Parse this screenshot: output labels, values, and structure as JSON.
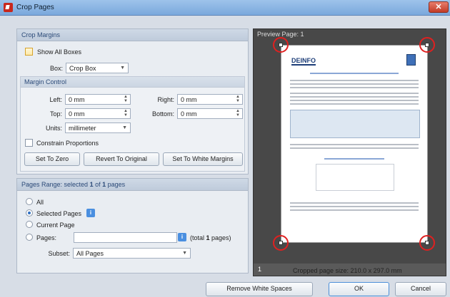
{
  "window": {
    "title": "Crop Pages",
    "close_label": "✕"
  },
  "crop_margins": {
    "header": "Crop Margins",
    "show_all_boxes_label": "Show All Boxes",
    "box_label": "Box:",
    "box_value": "Crop Box"
  },
  "margin_control": {
    "header": "Margin Control",
    "left_label": "Left:",
    "left_value": "0 mm",
    "right_label": "Right:",
    "right_value": "0 mm",
    "top_label": "Top:",
    "top_value": "0 mm",
    "bottom_label": "Bottom:",
    "bottom_value": "0 mm",
    "units_label": "Units:",
    "units_value": "millimeter",
    "constrain_label": "Constrain Proportions",
    "set_zero_label": "Set To Zero",
    "revert_label": "Revert To Original",
    "white_margins_label": "Set To White Margins"
  },
  "pages_range": {
    "header_prefix": "Pages Range: selected ",
    "selected_count": "1",
    "header_mid": " of ",
    "total_count": "1",
    "header_suffix": " pages",
    "all_label": "All",
    "selected_label": "Selected Pages",
    "current_label": "Current Page",
    "pages_label": "Pages:",
    "pages_value": "",
    "total_prefix": "(total ",
    "total_number": "1",
    "total_suffix": " pages)",
    "subset_label": "Subset:",
    "subset_value": "All Pages",
    "info_glyph": "i"
  },
  "preview": {
    "header": "Preview Page: 1",
    "page_number": "1",
    "cropped_size": "Cropped page size: 210.0 x 297.0 mm",
    "doc_logo": "DEINFO"
  },
  "buttons": {
    "remove_white": "Remove White Spaces",
    "ok": "OK",
    "cancel": "Cancel"
  },
  "colors": {
    "accent": "#4a8fe0",
    "highlight_circle": "#e02020"
  }
}
